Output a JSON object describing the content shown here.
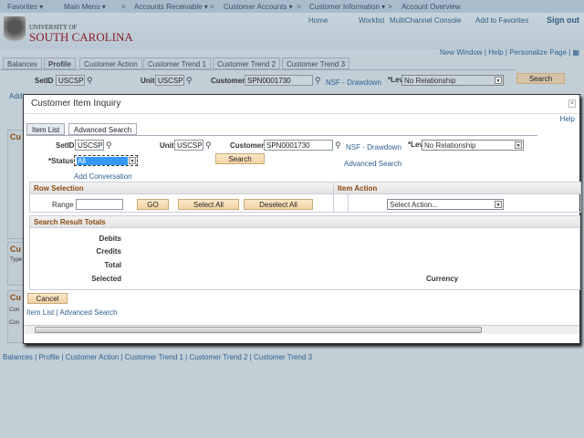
{
  "nav": {
    "items": [
      "Favorites ▾",
      "Main Menu ▾",
      ">",
      "Accounts Receivable ▾",
      ">",
      "Customer Accounts ▾",
      ">",
      "Customer Information ▾",
      ">",
      "Account Overview"
    ]
  },
  "header": {
    "logo_top": "UNIVERSITY OF",
    "logo_bottom": "SOUTH CAROLINA",
    "links": [
      "Home",
      "Worklist",
      "MultiChannel Console",
      "Add to Favorites",
      "Sign out"
    ]
  },
  "page_links": {
    "new_window": "New Window",
    "help": "Help",
    "personalize": "Personalize Page"
  },
  "bg_tabs": [
    "Balances",
    "Profile",
    "Customer Action",
    "Customer Trend 1",
    "Customer Trend 2",
    "Customer Trend 3"
  ],
  "bg_form": {
    "setid_label": "SetID",
    "setid": "USCSP",
    "unit_label": "Unit",
    "unit": "USCSP",
    "customer_label": "Customer",
    "customer": "SPN0001730",
    "customer_name": "NSF - Drawdown",
    "level_label": "*Lev",
    "level": "No Relationship",
    "search": "Search",
    "add_fragment": "Add",
    "cu": "Cu",
    "type": "Type",
    "con": "Con"
  },
  "modal": {
    "title": "Customer Item Inquiry",
    "help": "Help",
    "tabs": [
      "Item List",
      "Advanced Search"
    ],
    "setid_label": "SetID",
    "setid": "USCSP",
    "unit_label": "Unit",
    "unit": "USCSP",
    "customer_label": "Customer",
    "customer": "SPN0001730",
    "customer_name": "NSF - Drawdown",
    "level_label": "*Lev",
    "level": "No Relationship",
    "status_label": "*Status",
    "status": "All",
    "search": "Search",
    "advanced_search": "Advanced Search",
    "add_conversation": "Add Conversation",
    "row_selection": {
      "title": "Row Selection",
      "range_label": "Range",
      "range": "",
      "go": "GO",
      "select_all": "Select All",
      "deselect_all": "Deselect All"
    },
    "item_action": {
      "title": "Item Action",
      "select": "Select Action..."
    },
    "totals": {
      "title": "Search Result Totals",
      "debits": "Debits",
      "credits": "Credits",
      "total": "Total",
      "selected": "Selected",
      "currency": "Currency"
    },
    "cancel": "Cancel",
    "footer_links": [
      "Item List",
      "Advanced Search"
    ]
  },
  "bottom_links": [
    "Balances",
    "Profile",
    "Customer Action",
    "Customer Trend 1",
    "Customer Trend 2",
    "Customer Trend 3"
  ]
}
